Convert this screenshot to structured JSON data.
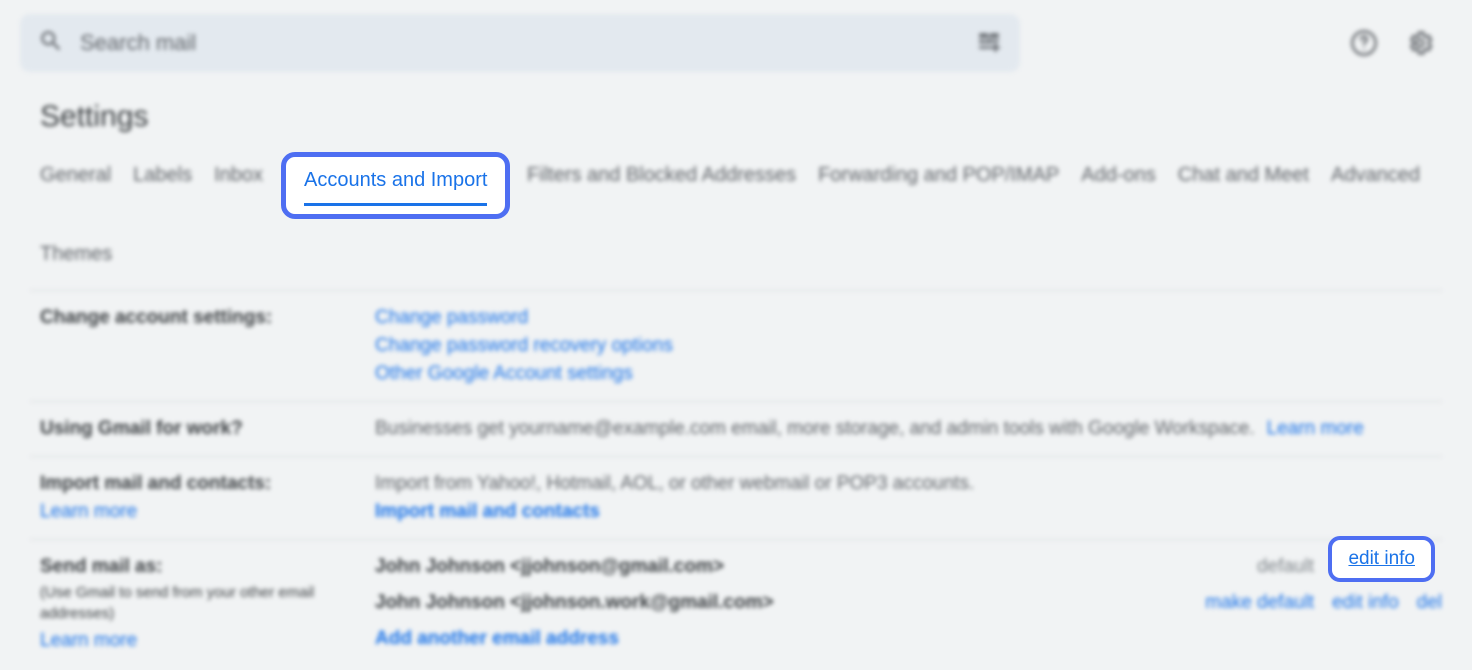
{
  "topbar": {
    "search_placeholder": "Search mail"
  },
  "page": {
    "title": "Settings",
    "tabs": [
      "General",
      "Labels",
      "Inbox",
      "Accounts and Import",
      "Filters and Blocked Addresses",
      "Forwarding and POP/IMAP",
      "Add-ons",
      "Chat and Meet",
      "Advanced",
      "Themes"
    ],
    "active_tab": "Accounts and Import"
  },
  "sections": {
    "change_account": {
      "label": "Change account settings:",
      "links": [
        "Change password",
        "Change password recovery options",
        "Other Google Account settings"
      ]
    },
    "work": {
      "label": "Using Gmail for work?",
      "text": "Businesses get yourname@example.com email, more storage, and admin tools with Google Workspace.",
      "learn_more": "Learn more"
    },
    "import": {
      "label": "Import mail and contacts:",
      "learn_more": "Learn more",
      "text": "Import from Yahoo!, Hotmail, AOL, or other webmail or POP3 accounts.",
      "action": "Import mail and contacts"
    },
    "send_as": {
      "label": "Send mail as:",
      "sub": "(Use Gmail to send from your other email addresses)",
      "learn_more": "Learn more",
      "rows": [
        {
          "email": "John Johnson <jjohnson@gmail.com>",
          "default": "default",
          "edit": "edit info"
        },
        {
          "email": "John Johnson <jjohnson.work@gmail.com>",
          "make_default": "make default",
          "edit": "edit info",
          "delete": "del"
        }
      ],
      "add": "Add another email address"
    }
  }
}
